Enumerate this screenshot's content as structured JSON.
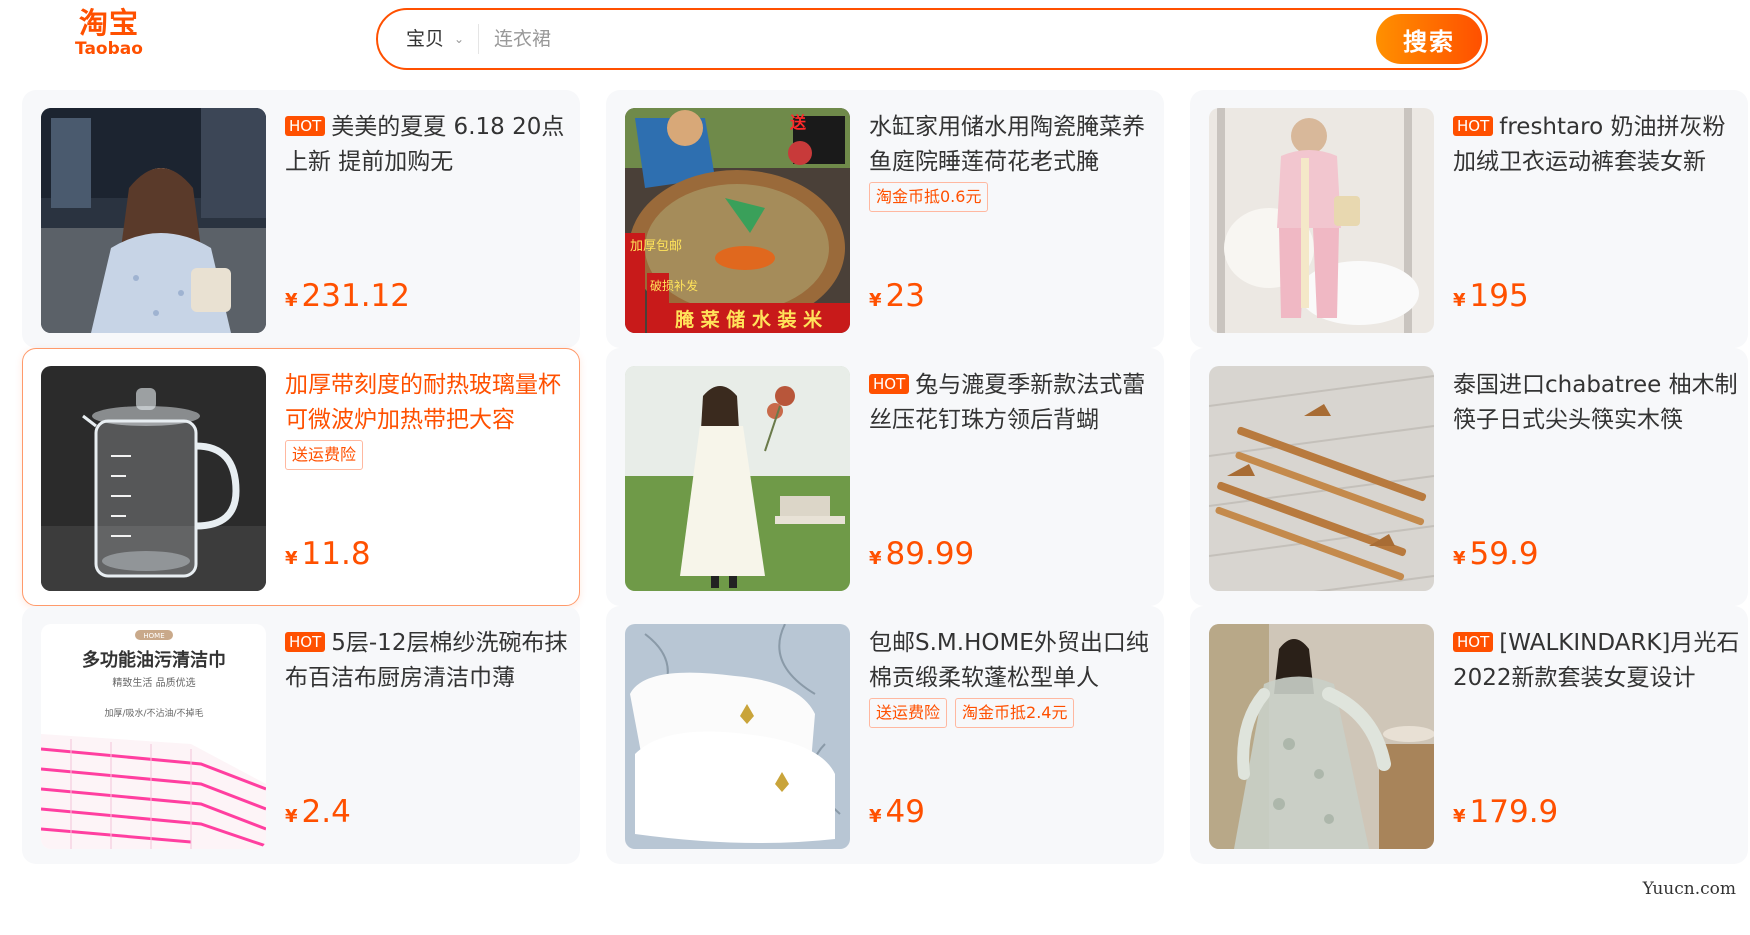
{
  "header": {
    "logo_cn": "淘宝",
    "logo_en": "Taobao",
    "search": {
      "category": "宝贝",
      "placeholder": "连衣裙",
      "button_label": "搜索"
    }
  },
  "products": [
    {
      "hot": "HOT",
      "title": "美美的夏夏 6.18 20点上新 提前加购无",
      "tags": [],
      "yen": "¥",
      "price": "231.12",
      "image": "woman-in-summer-dress-photo"
    },
    {
      "hot": "",
      "title": "水缸家用储水用陶瓷腌菜养鱼庭院睡莲荷花老式腌",
      "tags": [
        "淘金币抵0.6元"
      ],
      "yen": "¥",
      "price": "23",
      "image": "ceramic-water-vat-photo",
      "image_text": [
        "送",
        "加厚包邮",
        "破损补发",
        "腌 菜  储 水  装 米"
      ]
    },
    {
      "hot": "HOT",
      "title": "freshtaro 奶油拼灰粉加绒卫衣运动裤套装女新",
      "tags": [],
      "yen": "¥",
      "price": "195",
      "image": "pink-tracksuit-photo"
    },
    {
      "hot": "",
      "title": "加厚带刻度的耐热玻璃量杯可微波炉加热带把大容",
      "tags": [
        "送运费险"
      ],
      "yen": "¥",
      "price": "11.8",
      "image": "glass-measuring-jug-photo",
      "selected": true
    },
    {
      "hot": "HOT",
      "title": "兔与漉夏季新款法式蕾丝压花钉珠方领后背蝴",
      "tags": [],
      "yen": "¥",
      "price": "89.99",
      "image": "white-lace-dress-photo"
    },
    {
      "hot": "",
      "title": "泰国进口chabatree 柚木制筷子日式尖头筷实木筷",
      "tags": [],
      "yen": "¥",
      "price": "59.9",
      "image": "wooden-chopsticks-photo"
    },
    {
      "hot": "HOT",
      "title": "5层-12层棉纱洗碗布抹布百洁布厨房清洁巾薄",
      "tags": [],
      "yen": "¥",
      "price": "2.4",
      "image": "cleaning-cloth-photo",
      "image_text": [
        "HOME",
        "多功能油污清洁巾",
        "精致生活 品质优选",
        "加厚/吸水/不沾油/不掉毛"
      ]
    },
    {
      "hot": "",
      "title": "包邮S.M.HOME外贸出口纯棉贡缎柔软蓬松型单人",
      "tags": [
        "送运费险",
        "淘金币抵2.4元"
      ],
      "yen": "¥",
      "price": "49",
      "image": "white-pillows-photo"
    },
    {
      "hot": "HOT",
      "title": "[WALKINDARK]月光石2022新款套装女夏设计",
      "tags": [],
      "yen": "¥",
      "price": "179.9",
      "image": "sheer-grey-outfit-photo"
    }
  ],
  "watermark": "Yuucn.com"
}
